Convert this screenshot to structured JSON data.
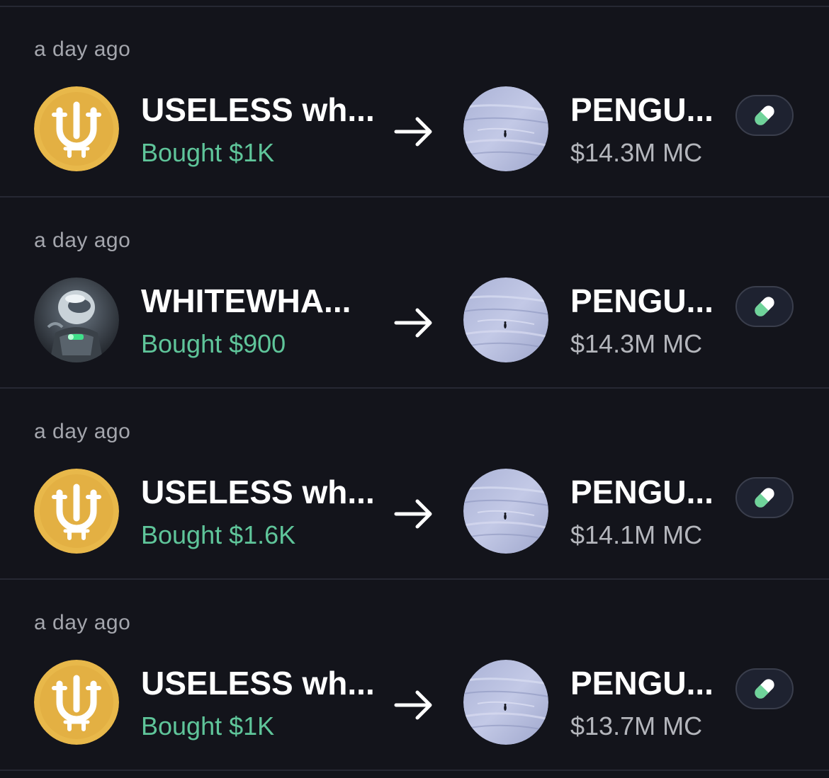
{
  "trades": [
    {
      "time": "a day ago",
      "trader": "USELESS wh...",
      "trader_avatar": "useless-logo",
      "action": "Bought $1K",
      "token": "PENGU...",
      "market_cap": "$14.3M MC",
      "token_image": "penguin-snowfield",
      "badge_icon": "pill-icon"
    },
    {
      "time": "a day ago",
      "trader": "WHITEWHA...",
      "trader_avatar": "robot-portrait",
      "action": "Bought $900",
      "token": "PENGU...",
      "market_cap": "$14.3M MC",
      "token_image": "penguin-snowfield",
      "badge_icon": "pill-icon"
    },
    {
      "time": "a day ago",
      "trader": "USELESS wh...",
      "trader_avatar": "useless-logo",
      "action": "Bought $1.6K",
      "token": "PENGU...",
      "market_cap": "$14.1M MC",
      "token_image": "penguin-snowfield",
      "badge_icon": "pill-icon"
    },
    {
      "time": "a day ago",
      "trader": "USELESS wh...",
      "trader_avatar": "useless-logo",
      "action": "Bought $1K",
      "token": "PENGU...",
      "market_cap": "$13.7M MC",
      "token_image": "penguin-snowfield",
      "badge_icon": "pill-icon"
    }
  ],
  "colors": {
    "background": "#13141b",
    "divider": "#262833",
    "bought": "#5fc59a",
    "muted": "#a4a6ad",
    "useless_gold": "#e8b84a",
    "pill_green": "#6fd39a"
  }
}
